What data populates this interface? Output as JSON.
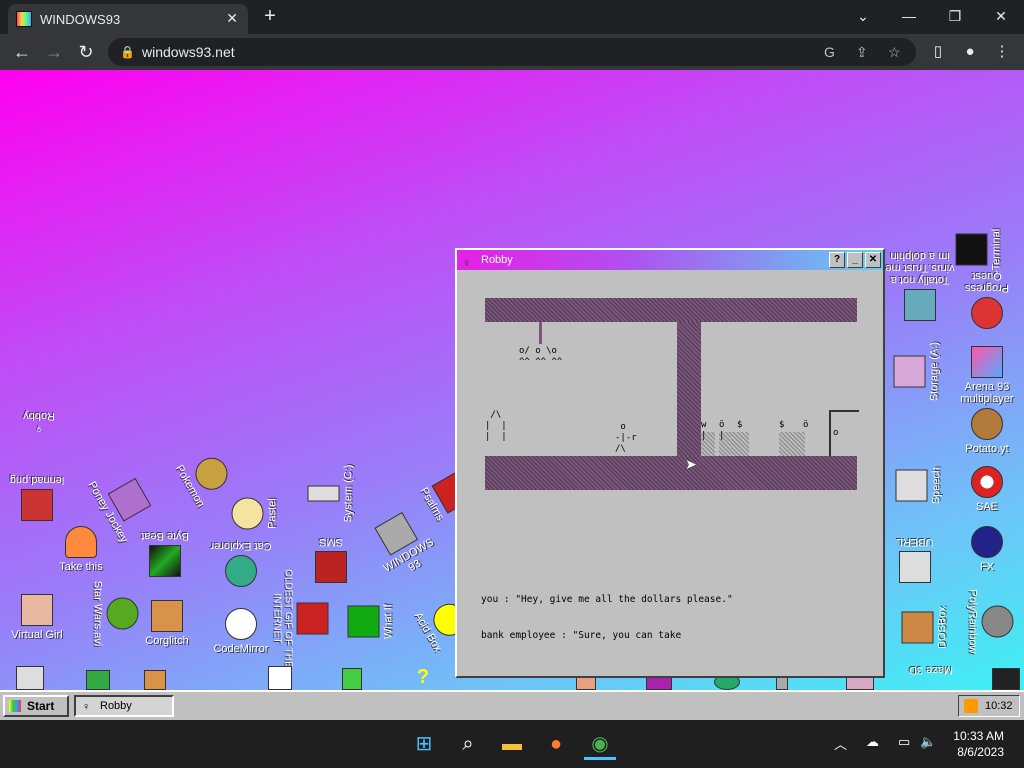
{
  "browser": {
    "tab_title": "WINDOWS93",
    "tab_close": "✕",
    "new_tab": "+",
    "url": "windows93.net",
    "controls": {
      "minimize": "—",
      "restore": "❐",
      "close": "✕",
      "list": "⌄"
    }
  },
  "desktop": {
    "icons": [
      {
        "label": "Robby"
      },
      {
        "label": "lennad.png"
      },
      {
        "label": "Take this"
      },
      {
        "label": "Virtual Girl"
      },
      {
        "label": "Poney Jockey"
      },
      {
        "label": "Byte Beat"
      },
      {
        "label": "Star Wars.avi"
      },
      {
        "label": "Corglitch"
      },
      {
        "label": "Pokemon"
      },
      {
        "label": "Pastel"
      },
      {
        "label": "Cat Explorer"
      },
      {
        "label": "CodeMirror"
      },
      {
        "label": "System (C:)"
      },
      {
        "label": "SMS"
      },
      {
        "label": "OLDEST GIF OF THE INTERNET"
      },
      {
        "label": "WINDOWS 93"
      },
      {
        "label": "What If"
      },
      {
        "label": "Psalms"
      },
      {
        "label": "Acid Box"
      },
      {
        "label": "Terminal"
      },
      {
        "label": "Totally not a virus.Trust me im a dolphin"
      },
      {
        "label": "Progress Quest"
      },
      {
        "label": "Storage (A:)"
      },
      {
        "label": "Arena 93 multiplayer"
      },
      {
        "label": "Potato.yt"
      },
      {
        "label": "Speech"
      },
      {
        "label": "SAE"
      },
      {
        "label": "UBERL"
      },
      {
        "label": "FX"
      },
      {
        "label": "DOSBox"
      },
      {
        "label": "PolyRainbow"
      },
      {
        "label": "Maze 3D"
      }
    ]
  },
  "robby": {
    "title": "Robby",
    "help": "?",
    "minimize": "_",
    "close": "✕",
    "scene": {
      "victims": "o/ o \\o\n^^ ^^ ^^",
      "house": " /\\\n|  |\n|  |",
      "robber": " o\n-|-r\n/\\",
      "teller1": "w\n|",
      "teller2": "ö\n|",
      "money1": "$",
      "money2": "$",
      "teller3": "ö",
      "door_knob": "o"
    },
    "dialog_line1": "you : \"Hey, give me all the dollars please.\"",
    "dialog_line2": "bank employee : \"Sure, you can take"
  },
  "w93_taskbar": {
    "start": "Start",
    "task": "Robby",
    "tray_time": "10:32"
  },
  "win_taskbar": {
    "time": "10:33 AM",
    "date": "8/6/2023"
  }
}
